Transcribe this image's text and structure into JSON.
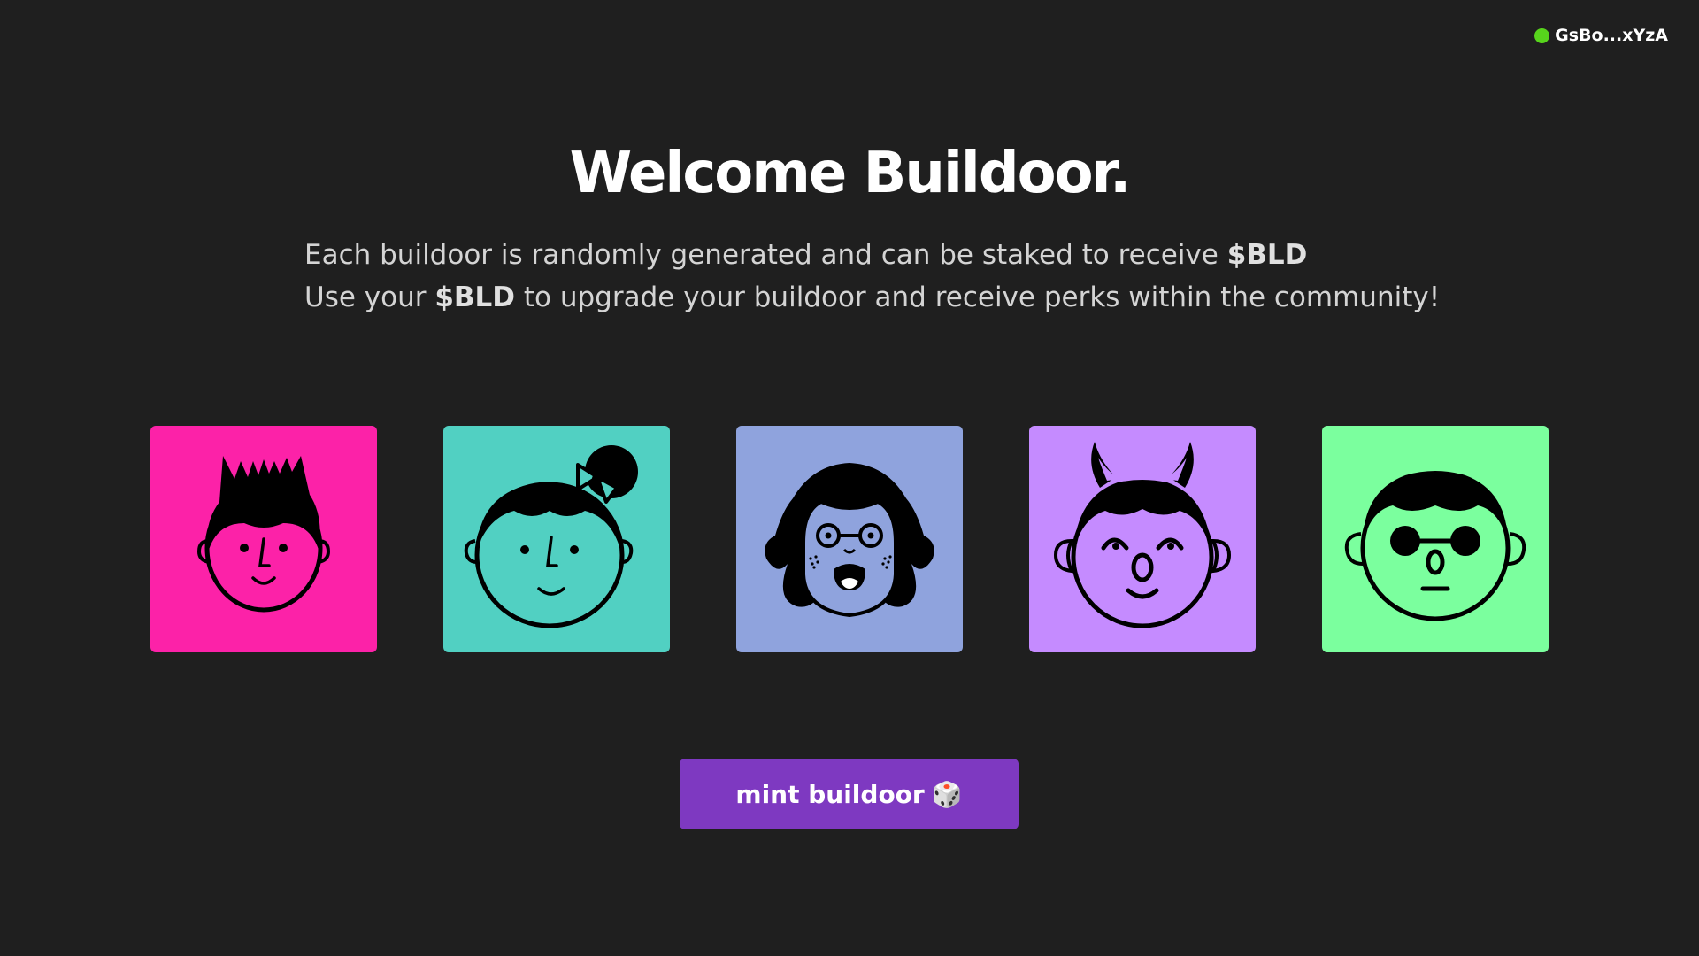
{
  "wallet": {
    "address": "GsBo...xYzA",
    "status_color": "#57d41c"
  },
  "header": {
    "title": "Welcome Buildoor."
  },
  "description": {
    "line1_prefix": "Each buildoor is randomly generated and can be staked to receive ",
    "line1_token": "$BLD",
    "line2_prefix": "Use your ",
    "line2_token": "$BLD",
    "line2_suffix": " to upgrade your buildoor and receive perks within the community!"
  },
  "avatars": [
    {
      "name": "spiky-hair-buildoor",
      "color": "#fc22a8"
    },
    {
      "name": "bow-buildoor",
      "color": "#51d0c2"
    },
    {
      "name": "glasses-girl-buildoor",
      "color": "#8fa3dd"
    },
    {
      "name": "devil-horns-buildoor",
      "color": "#c58bff"
    },
    {
      "name": "sunglasses-buildoor",
      "color": "#7bff9e"
    }
  ],
  "mint_button": {
    "label": "mint buildoor",
    "icon": "dice-icon",
    "color": "#7e39c1"
  }
}
